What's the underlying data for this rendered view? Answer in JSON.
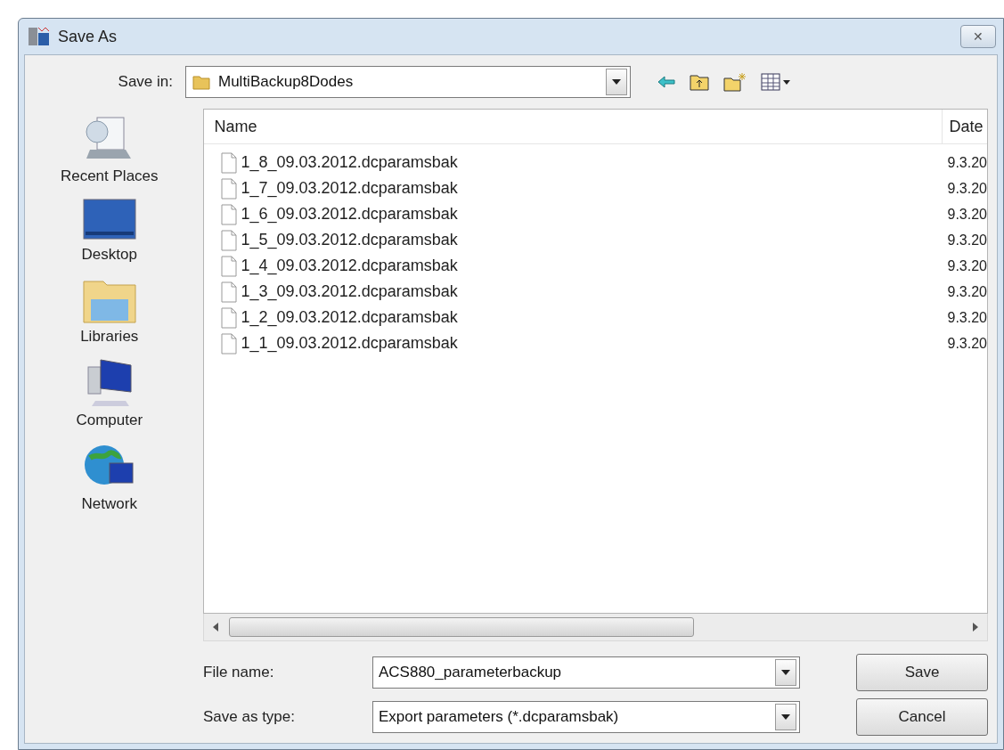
{
  "window": {
    "title": "Save As",
    "close": "✕"
  },
  "save_in": {
    "label": "Save in:",
    "value": "MultiBackup8Dodes"
  },
  "places": [
    {
      "label": "Recent Places",
      "kind": "recent"
    },
    {
      "label": "Desktop",
      "kind": "desktop"
    },
    {
      "label": "Libraries",
      "kind": "libraries"
    },
    {
      "label": "Computer",
      "kind": "computer"
    },
    {
      "label": "Network",
      "kind": "network"
    }
  ],
  "file_list": {
    "columns": [
      "Name",
      "Date"
    ],
    "rows": [
      {
        "name": "1_8_09.03.2012.dcparamsbak",
        "date": "9.3.20"
      },
      {
        "name": "1_7_09.03.2012.dcparamsbak",
        "date": "9.3.20"
      },
      {
        "name": "1_6_09.03.2012.dcparamsbak",
        "date": "9.3.20"
      },
      {
        "name": "1_5_09.03.2012.dcparamsbak",
        "date": "9.3.20"
      },
      {
        "name": "1_4_09.03.2012.dcparamsbak",
        "date": "9.3.20"
      },
      {
        "name": "1_3_09.03.2012.dcparamsbak",
        "date": "9.3.20"
      },
      {
        "name": "1_2_09.03.2012.dcparamsbak",
        "date": "9.3.20"
      },
      {
        "name": "1_1_09.03.2012.dcparamsbak",
        "date": "9.3.20"
      }
    ]
  },
  "file_name": {
    "label": "File name:",
    "value": "ACS880_parameterbackup"
  },
  "save_as_type": {
    "label": "Save as type:",
    "value": "Export parameters (*.dcparamsbak)"
  },
  "buttons": [
    "Save",
    "Cancel"
  ]
}
